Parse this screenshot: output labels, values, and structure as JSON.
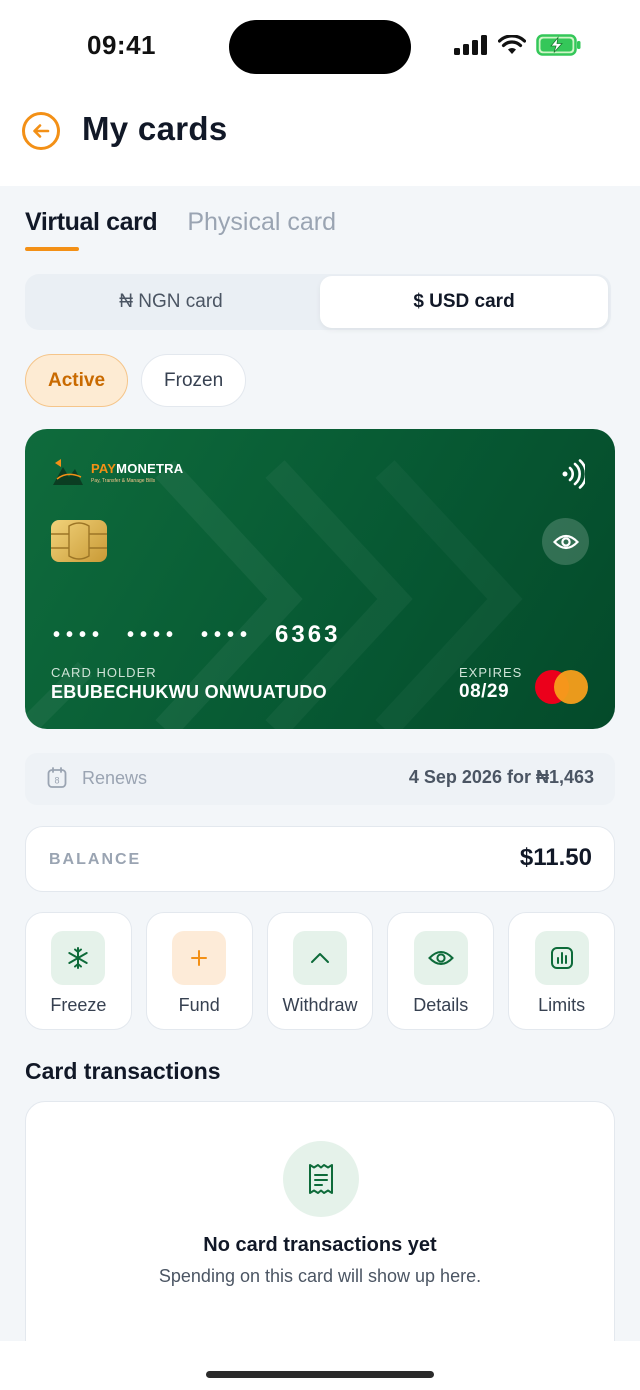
{
  "status_bar": {
    "time": "09:41"
  },
  "header": {
    "title": "My cards"
  },
  "tabs": [
    {
      "label": "Virtual card",
      "active": true
    },
    {
      "label": "Physical card",
      "active": false
    }
  ],
  "currency_switch": {
    "ngn_label": "₦ NGN card",
    "usd_label": "$ USD card",
    "selected": "usd"
  },
  "filters": [
    {
      "label": "Active",
      "active": true
    },
    {
      "label": "Frozen",
      "active": false
    }
  ],
  "card": {
    "brand_pay": "PAY",
    "brand_monetra": "MONETRA",
    "brand_tagline": "Pay, Transfer & Manage Bills",
    "masked_groups": [
      "••••",
      "••••",
      "••••"
    ],
    "last4": "6363",
    "holder_label": "CARD HOLDER",
    "holder_name": "EBUBECHUKWU ONWUATUDO",
    "expires_label": "EXPIRES",
    "expires_value": "08/29",
    "network_icon": "mastercard-icon",
    "colors": {
      "card_bg": "#075933",
      "accent": "#F39016"
    }
  },
  "renewal": {
    "calendar_day": "8",
    "label": "Renews",
    "value": "4 Sep 2026 for ₦1,463"
  },
  "balance": {
    "label": "BALANCE",
    "value": "$11.50"
  },
  "actions": [
    {
      "label": "Freeze",
      "icon": "snowflake-icon"
    },
    {
      "label": "Fund",
      "icon": "plus-icon"
    },
    {
      "label": "Withdraw",
      "icon": "chevron-up-icon"
    },
    {
      "label": "Details",
      "icon": "eye-icon"
    },
    {
      "label": "Limits",
      "icon": "bar-chart-icon"
    }
  ],
  "transactions": {
    "section_title": "Card transactions",
    "empty_title": "No card transactions yet",
    "empty_subtitle": "Spending on this card will show up here."
  }
}
